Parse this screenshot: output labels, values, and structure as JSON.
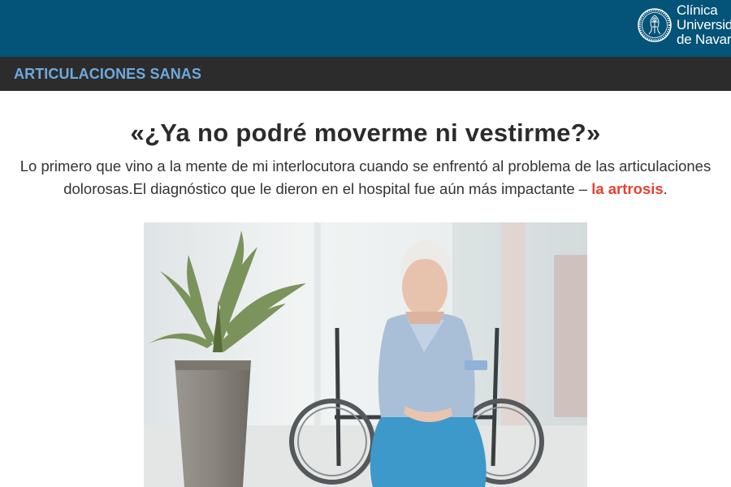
{
  "header": {
    "logo": {
      "line1": "Clínica",
      "line2": "Universidad",
      "line3": "de Navarra"
    }
  },
  "section": {
    "title": "ARTICULACIONES SANAS"
  },
  "article": {
    "headline": "«¿Ya no podré moverme ni vestirme?»",
    "intro_text": "Lo primero que vino a la mente de mi interlocutora cuando se enfrentó al problema de las articulaciones dolorosas.El diagnóstico que le dieron en el hospital fue aún más impactante – ",
    "intro_link": "la artrosis",
    "intro_end": "."
  },
  "colors": {
    "header_bg": "#045378",
    "section_bar_bg": "#2c2c2c",
    "section_title": "#6fa9df",
    "highlight": "#e8402f"
  }
}
